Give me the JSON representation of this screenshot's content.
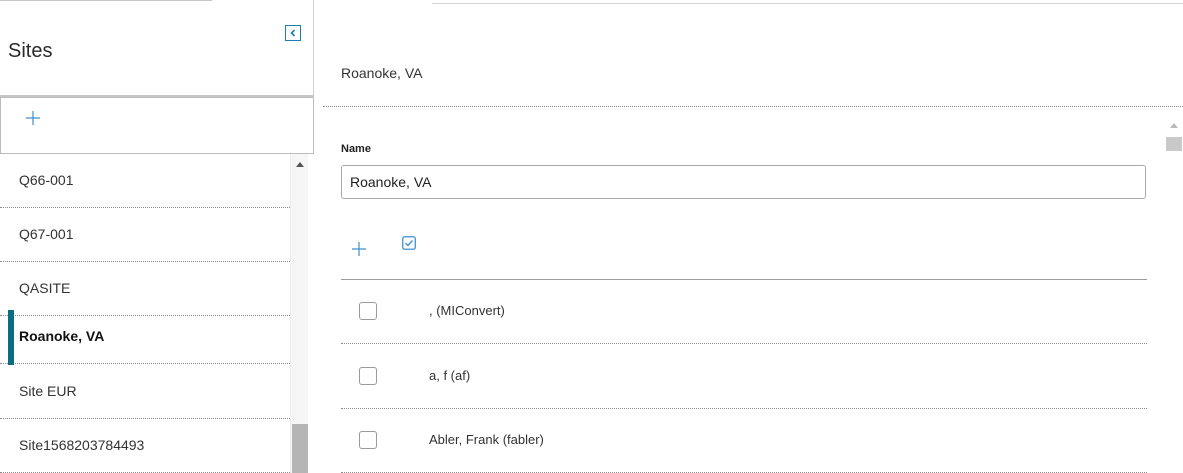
{
  "sidebar": {
    "title": "Sites",
    "items": [
      {
        "label": "Q66-001",
        "active": false
      },
      {
        "label": "Q67-001",
        "active": false
      },
      {
        "label": "QASITE",
        "active": false
      },
      {
        "label": "Roanoke, VA",
        "active": true
      },
      {
        "label": "Site EUR",
        "active": false
      },
      {
        "label": "Site1568203784493",
        "active": false
      }
    ]
  },
  "detail": {
    "title": "Roanoke, VA",
    "name_label": "Name",
    "name_value": "Roanoke, VA",
    "users": [
      {
        "label": ", (MIConvert)",
        "checked": false
      },
      {
        "label": "a, f (af)",
        "checked": false
      },
      {
        "label": "Abler, Frank (fabler)",
        "checked": false
      }
    ]
  },
  "icons": {
    "collapse": "chevron-left-icon",
    "add_site": "plus-icon",
    "add_user": "plus-icon",
    "select_all": "checkbox-checked-icon"
  },
  "colors": {
    "accent": "#1b7fb2",
    "active_bar": "#0c6d80"
  }
}
